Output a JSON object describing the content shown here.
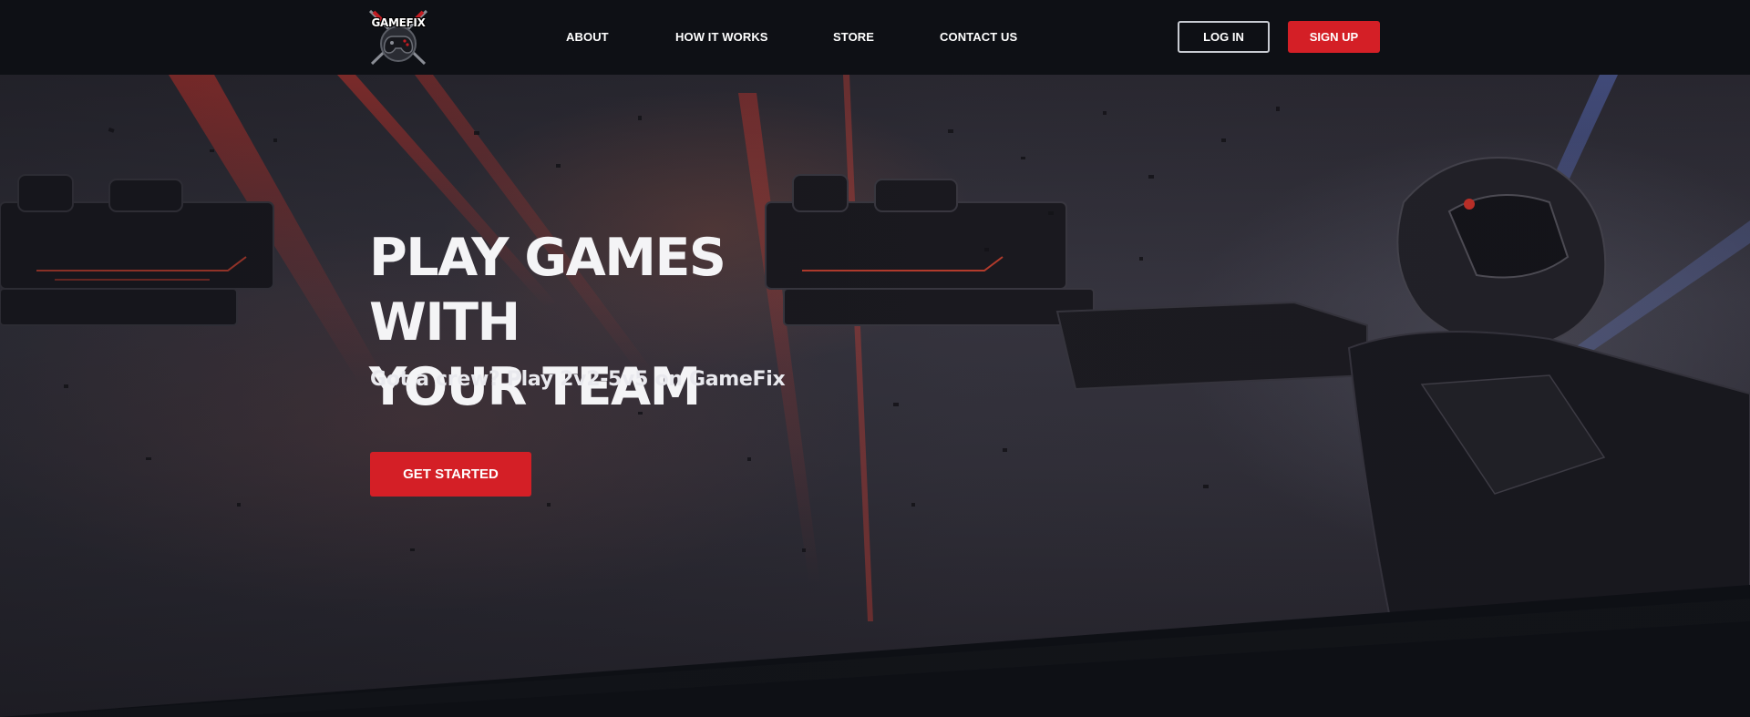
{
  "brand": {
    "logo_text": "GAMEFIX"
  },
  "nav": {
    "links": [
      {
        "label": "ABOUT"
      },
      {
        "label": "HOW IT WORKS"
      },
      {
        "label": "STORE"
      },
      {
        "label": "CONTACT US"
      }
    ],
    "login_label": "LOG IN",
    "signup_label": "SIGN UP"
  },
  "hero": {
    "title": "PLAY GAMES WITH\nYOUR TEAM",
    "subtitle": "Got a crew? Play 2v2-5v5 on GameFix",
    "cta_label": "GET STARTED"
  },
  "colors": {
    "background": "#0e1015",
    "accent": "#d41f26",
    "text": "#ffffff"
  }
}
